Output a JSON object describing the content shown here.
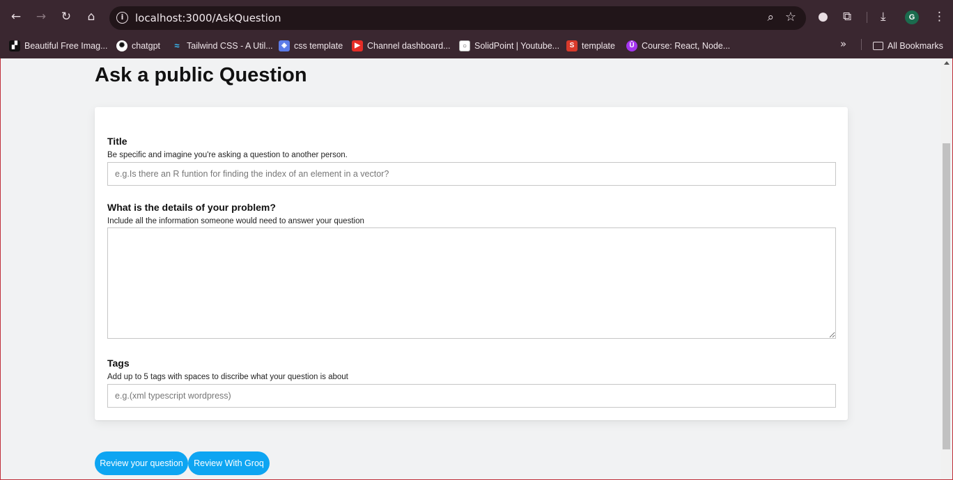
{
  "browser": {
    "url": "localhost:3000/AskQuestion",
    "profile_initial": "G",
    "all_bookmarks_label": "All Bookmarks",
    "bookmarks": [
      {
        "label": "Beautiful Free Imag...",
        "icon": "unsplash-icon"
      },
      {
        "label": "chatgpt",
        "icon": "openai-icon"
      },
      {
        "label": "Tailwind CSS - A Util...",
        "icon": "tailwind-icon"
      },
      {
        "label": "css template",
        "icon": "layers-icon"
      },
      {
        "label": "Channel dashboard...",
        "icon": "youtube-icon"
      },
      {
        "label": "SolidPoint | Youtube...",
        "icon": "solidpoint-icon"
      },
      {
        "label": "template",
        "icon": "s-icon"
      },
      {
        "label": "Course: React, Node...",
        "icon": "udemy-icon"
      }
    ]
  },
  "page": {
    "title": "Ask a public Question",
    "form": {
      "title_label": "Title",
      "title_help": "Be specific and imagine you're asking a question to another person.",
      "title_placeholder": "e.g.Is there an R funtion for finding the index of an element in a vector?",
      "details_label": "What is the details of your problem?",
      "details_help": "Include all the information someone would need to answer your question",
      "tags_label": "Tags",
      "tags_help": "Add up to 5 tags with spaces to discribe what your question is about",
      "tags_placeholder": "e.g.(xml typescript wordpress)"
    },
    "buttons": {
      "review": "Review your question",
      "groq": "Review With Groq"
    }
  },
  "colors": {
    "chrome": "#3a2730",
    "omnibox": "#211519",
    "page_bg": "#f1f2f3",
    "accent_button": "#0ea5f2"
  }
}
